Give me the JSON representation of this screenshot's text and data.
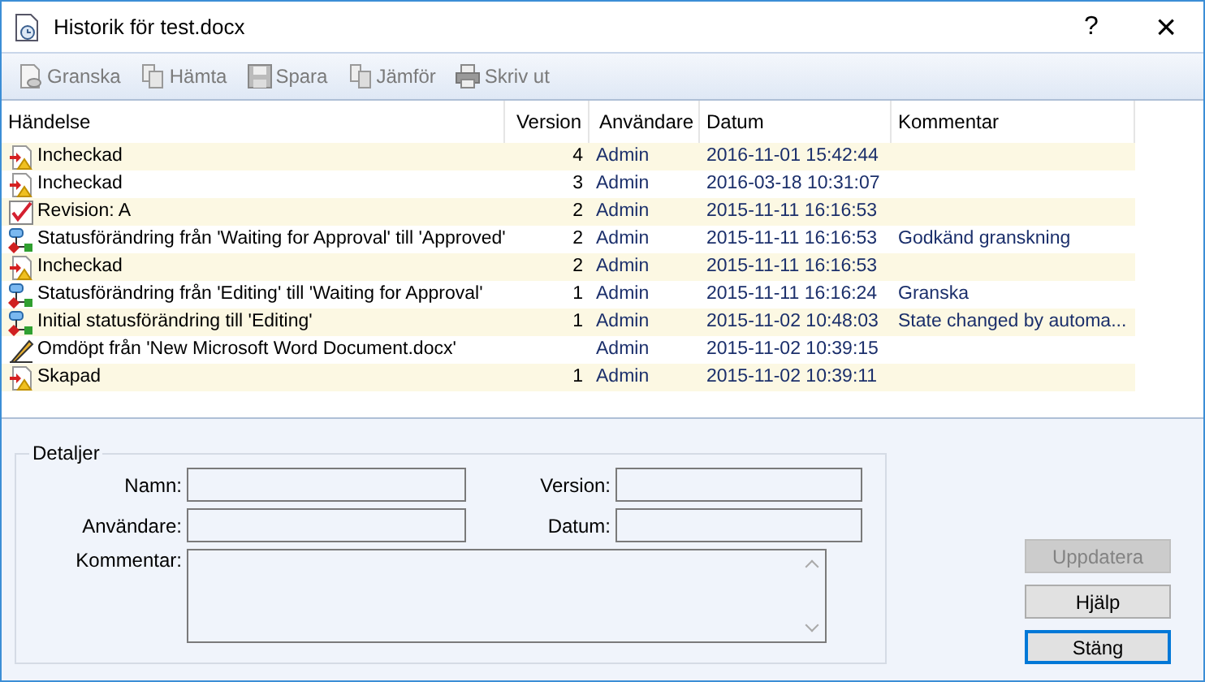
{
  "window": {
    "title": "Historik för test.docx",
    "help": "?",
    "close": "×"
  },
  "toolbar": [
    {
      "label": "Granska",
      "kind": "review",
      "disabled": true
    },
    {
      "label": "Hämta",
      "kind": "fetch",
      "disabled": true
    },
    {
      "label": "Spara",
      "kind": "save",
      "disabled": true
    },
    {
      "label": "Jämför",
      "kind": "compare",
      "disabled": true
    },
    {
      "label": "Skriv ut",
      "kind": "print",
      "disabled": true
    }
  ],
  "table": {
    "columns": [
      "Händelse",
      "Version",
      "Användare",
      "Datum",
      "Kommentar"
    ],
    "rows": [
      {
        "kind": "checkin",
        "event": "Incheckad",
        "version": "4",
        "user": "Admin",
        "date": "2016-11-01 15:42:44",
        "comment": ""
      },
      {
        "kind": "checkin",
        "event": "Incheckad",
        "version": "3",
        "user": "Admin",
        "date": "2016-03-18 10:31:07",
        "comment": ""
      },
      {
        "kind": "revision",
        "event": "Revision: A",
        "version": "2",
        "user": "Admin",
        "date": "2015-11-11 16:16:53",
        "comment": ""
      },
      {
        "kind": "status",
        "event": "Statusförändring från 'Waiting for Approval' till 'Approved'",
        "version": "2",
        "user": "Admin",
        "date": "2015-11-11 16:16:53",
        "comment": "Godkänd granskning"
      },
      {
        "kind": "checkin",
        "event": "Incheckad",
        "version": "2",
        "user": "Admin",
        "date": "2015-11-11 16:16:53",
        "comment": ""
      },
      {
        "kind": "status",
        "event": "Statusförändring från 'Editing' till 'Waiting for Approval'",
        "version": "1",
        "user": "Admin",
        "date": "2015-11-11 16:16:24",
        "comment": "Granska"
      },
      {
        "kind": "status",
        "event": "Initial statusförändring till 'Editing'",
        "version": "1",
        "user": "Admin",
        "date": "2015-11-02 10:48:03",
        "comment": "State changed by automa..."
      },
      {
        "kind": "rename",
        "event": "Omdöpt från 'New Microsoft Word Document.docx'",
        "version": "",
        "user": "Admin",
        "date": "2015-11-02 10:39:15",
        "comment": ""
      },
      {
        "kind": "checkin",
        "event": "Skapad",
        "version": "1",
        "user": "Admin",
        "date": "2015-11-02 10:39:11",
        "comment": ""
      }
    ]
  },
  "details": {
    "title": "Detaljer",
    "name_label": "Namn:",
    "version_label": "Version:",
    "user_label": "Användare:",
    "date_label": "Datum:",
    "comment_label": "Kommentar:"
  },
  "buttons": [
    {
      "label": "Uppdatera",
      "disabled": true,
      "default": false
    },
    {
      "label": "Hjälp",
      "disabled": false,
      "default": false
    },
    {
      "label": "Stäng",
      "disabled": false,
      "default": true
    }
  ]
}
